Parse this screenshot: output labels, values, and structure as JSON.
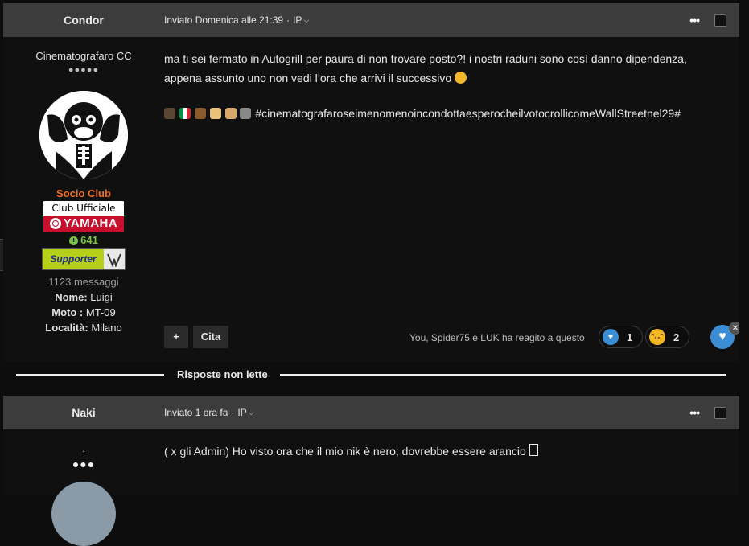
{
  "post1": {
    "author": "Condor",
    "meta": {
      "posted": "Inviato Domenica alle 21:39",
      "ip_label": "IP"
    },
    "menu_icon": "ellipsis-icon",
    "rank_title": "Cinematografaro CC",
    "pips": "●●●●●",
    "group": "Socio Club",
    "club_badge": {
      "top": "Club Ufficiale",
      "brand": "YAMAHA"
    },
    "reputation": "641",
    "supporter_badge": "Supporter",
    "messages": "1123 messaggi",
    "fields": [
      {
        "label": "Nome:",
        "value": "Luigi"
      },
      {
        "label": "Moto :",
        "value": "MT-09"
      },
      {
        "label": "Località:",
        "value": "Milano"
      }
    ],
    "body_line1": "ma ti sei fermato in Autogrill per paura di non trovare posto?! i nostri raduni sono così danno dipendenza,",
    "body_line2": "appena assunto uno non vedi l’ora che arrivi il successivo",
    "hashtag": "#cinematografaroseimenomenoincondottaesperocheilvotocrollicomeWallStreetnel29#",
    "actions": {
      "plus": "+",
      "quote": "Cita"
    },
    "reacted_text": "You, Spider75 e LUK ha reagito a questo",
    "reactions": [
      {
        "icon": "heart-reaction-icon",
        "count": "1"
      },
      {
        "icon": "laugh-reaction-icon",
        "count": "2"
      }
    ]
  },
  "divider": {
    "label": "Risposte non lette"
  },
  "post2": {
    "author": "Naki",
    "meta": {
      "posted": "Inviato 1 ora fa",
      "ip_label": "IP"
    },
    "rank_title": ".",
    "pips": "●●●",
    "body": "( x gli Admin) Ho visto ora che il mio nik è nero; dovrebbe essere arancio"
  },
  "colors": {
    "background": "#0d0d0d",
    "header": "#3c3c3c",
    "group_orange": "#f26c21",
    "reputation_green": "#76c743",
    "reaction_blue": "#3b8ed6"
  }
}
